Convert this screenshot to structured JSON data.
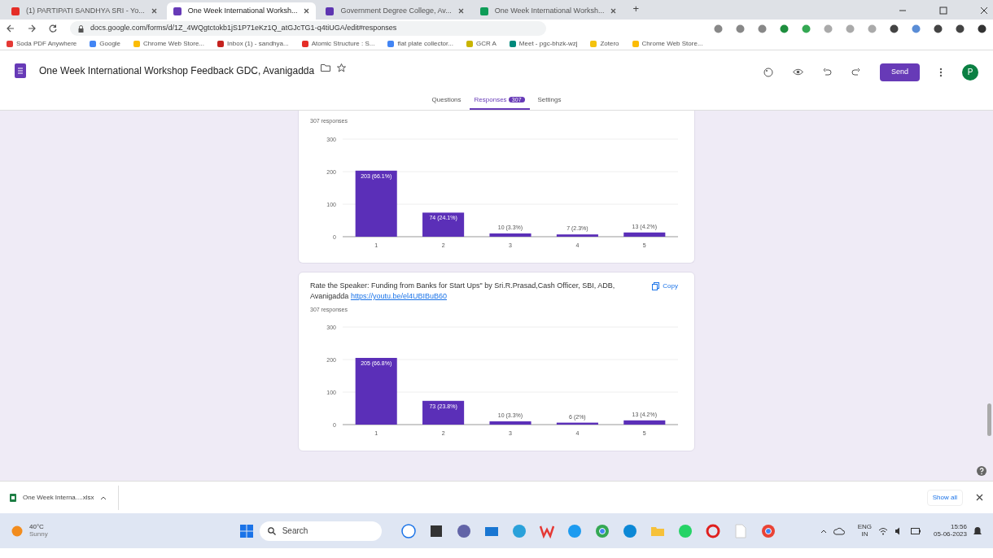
{
  "browser_tabs": [
    {
      "title": "(1) PARTIPATI SANDHYA SRI - Yo...",
      "selected": false,
      "color": "#e52d27"
    },
    {
      "title": "One Week International Worksh...",
      "selected": true,
      "color": "#673ab7"
    },
    {
      "title": "Government Degree College, Av...",
      "selected": false,
      "color": "#5e35b1"
    },
    {
      "title": "One Week International Worksh...",
      "selected": false,
      "color": "#0f9d58"
    }
  ],
  "new_tab": "+",
  "address": "docs.google.com/forms/d/1Z_4WQgtctokb1jS1P71eKz1Q_atGJcTG1-q4tiUGA/edit#responses",
  "bookmarks": [
    {
      "label": "Soda PDF Anywhere",
      "color": "#e53935"
    },
    {
      "label": "Google",
      "color": "#4285f4"
    },
    {
      "label": "Chrome Web Store...",
      "color": "#fbbc05"
    },
    {
      "label": "Inbox (1) - sandhya...",
      "color": "#c5221f"
    },
    {
      "label": "Atomic Structure : S...",
      "color": "#e52d27"
    },
    {
      "label": "flat plate collector...",
      "color": "#4285f4"
    },
    {
      "label": "GCR A",
      "color": "#c9b400"
    },
    {
      "label": "Meet - pgc-bhzk-wzj",
      "color": "#00897b"
    },
    {
      "label": "Zotero",
      "color": "#f4c20d"
    },
    {
      "label": "Chrome Web Store...",
      "color": "#fbbc05"
    }
  ],
  "form": {
    "title": "One Week International Workshop Feedback GDC, Avanigadda",
    "send": "Send",
    "avatar": "P",
    "tabs": [
      {
        "label": "Questions",
        "selected": false
      },
      {
        "label": "Responses",
        "selected": true,
        "badge": "307"
      },
      {
        "label": "Settings",
        "selected": false
      }
    ]
  },
  "cards": [
    {
      "responses": "307 responses",
      "chart_data": {
        "type": "bar",
        "categories": [
          "1",
          "2",
          "3",
          "4",
          "5"
        ],
        "values": [
          203,
          74,
          10,
          7,
          13
        ],
        "ylim": [
          0,
          300
        ],
        "yticks": [
          0,
          100,
          200,
          300
        ],
        "value_labels": [
          "203 (66.1%)",
          "74 (24.1%)",
          "10 (3.3%)",
          "7 (2.3%)",
          "13 (4.2%)"
        ]
      }
    },
    {
      "title": "Rate the Speaker: Funding from Banks for Start Ups\" by Sri.R.Prasad,Cash Officer, SBI, ADB, Avanigadda",
      "link": "https://youtu.be/el4UBIBuB60",
      "copy": "Copy",
      "responses": "307 responses",
      "chart_data": {
        "type": "bar",
        "categories": [
          "1",
          "2",
          "3",
          "4",
          "5"
        ],
        "values": [
          205,
          73,
          10,
          6,
          13
        ],
        "ylim": [
          0,
          300
        ],
        "yticks": [
          0,
          100,
          200,
          300
        ],
        "value_labels": [
          "205 (66.8%)",
          "73 (23.8%)",
          "10 (3.3%)",
          "6 (2%)",
          "13 (4.2%)"
        ]
      }
    }
  ],
  "download": {
    "file": "One Week Interna....xlsx",
    "show_all": "Show all"
  },
  "taskbar": {
    "temperature": "40°C",
    "weather": "Sunny",
    "search": "Search",
    "language": "ENG",
    "region": "IN",
    "time": "15:56",
    "date": "05-06-2023"
  }
}
